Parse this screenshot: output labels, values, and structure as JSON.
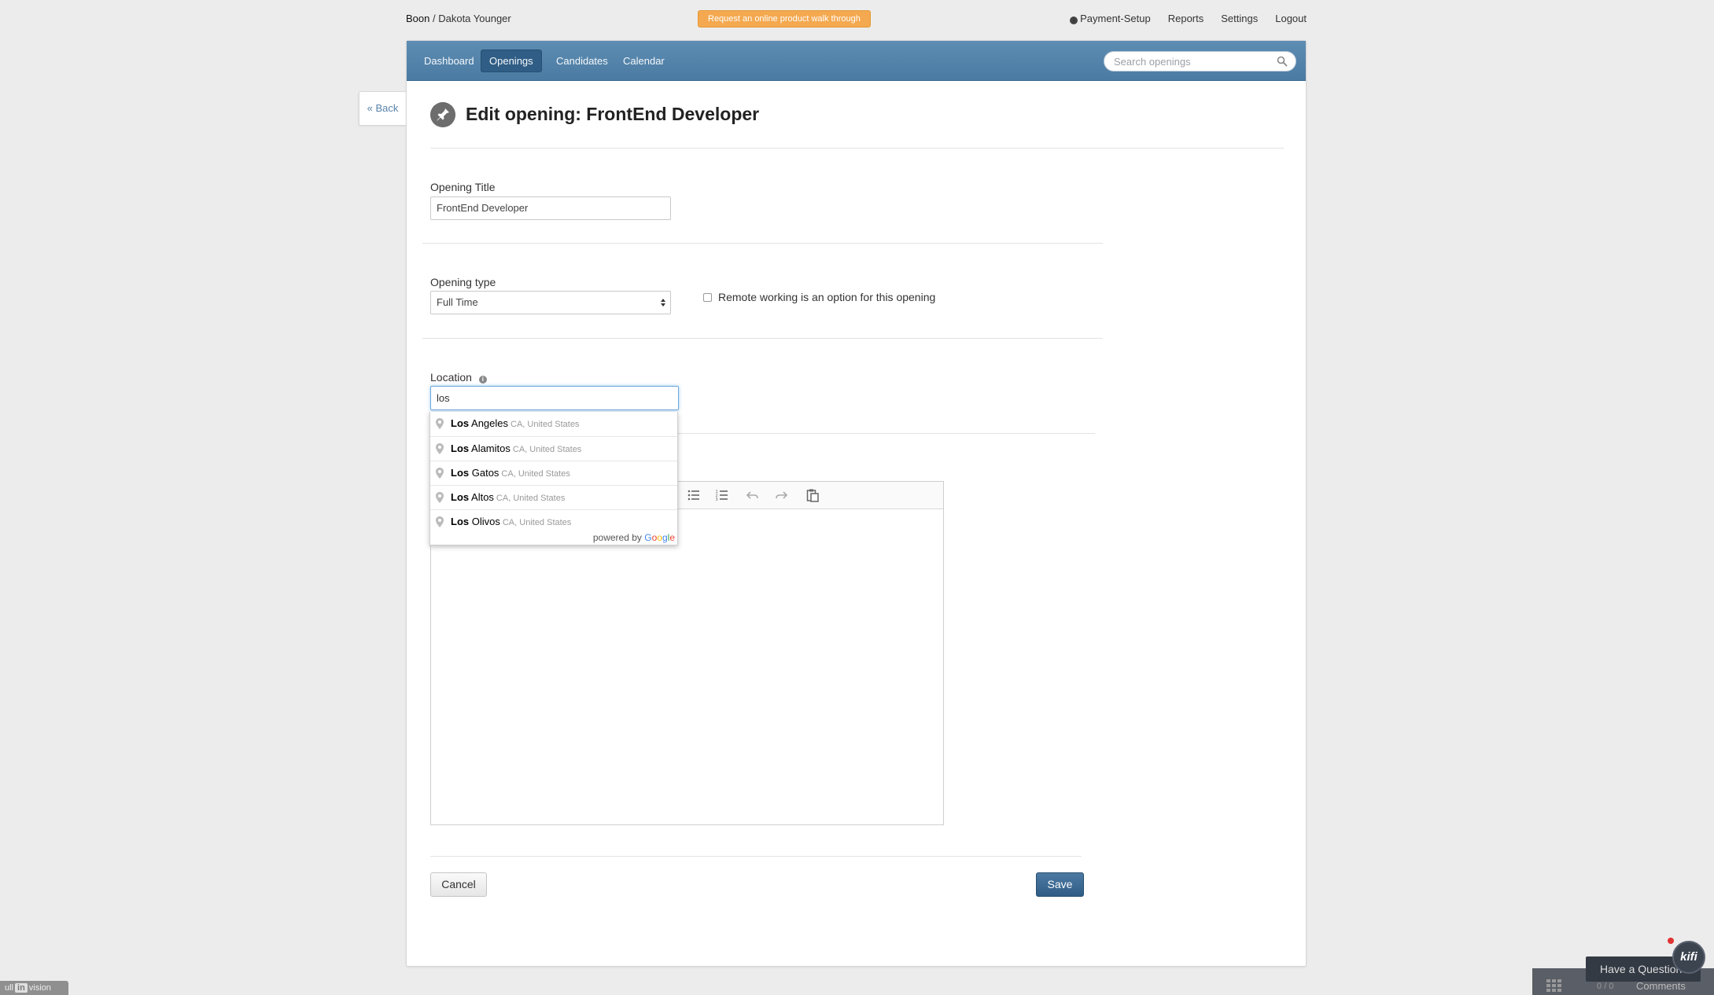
{
  "header": {
    "company": "Boon",
    "separator": " / ",
    "user": "Dakota Younger",
    "walkthrough_button": "Request an online product walk through",
    "links": {
      "payment_setup": "Payment-Setup",
      "reports": "Reports",
      "settings": "Settings",
      "logout": "Logout"
    }
  },
  "nav": {
    "items": [
      {
        "label": "Dashboard"
      },
      {
        "label": "Openings",
        "active": true
      },
      {
        "label": "Candidates"
      },
      {
        "label": "Calendar"
      }
    ],
    "search_placeholder": "Search openings"
  },
  "back_button": "« Back",
  "page_title": "Edit opening: FrontEnd Developer",
  "form": {
    "title_label": "Opening Title",
    "title_value": "FrontEnd Developer",
    "type_label": "Opening type",
    "type_value": "Full Time",
    "remote_label": "Remote working is an option for this opening",
    "remote_checked": false,
    "location_label": "Location",
    "location_value": "los",
    "cancel_label": "Cancel",
    "save_label": "Save"
  },
  "autocomplete": {
    "items": [
      {
        "match": "Los",
        "rest": " Angeles",
        "secondary": "CA, United States"
      },
      {
        "match": "Los",
        "rest": " Alamitos",
        "secondary": "CA, United States"
      },
      {
        "match": "Los",
        "rest": " Gatos",
        "secondary": "CA, United States"
      },
      {
        "match": "Los",
        "rest": " Altos",
        "secondary": "CA, United States"
      },
      {
        "match": "Los",
        "rest": " Olivos",
        "secondary": "CA, United States"
      }
    ],
    "powered_by": "powered by",
    "google": [
      "G",
      "o",
      "o",
      "g",
      "l",
      "e"
    ]
  },
  "widgets": {
    "invision_prefix": "ull",
    "invision_tag": "in",
    "invision_text": "vision",
    "count_a": "0",
    "count_sep": "/",
    "count_b": "0",
    "comments": "Comments",
    "question": "Have a Question?",
    "kifi": "kifi"
  },
  "colors": {
    "nav_blue": "#4b7aa2",
    "walkthrough_orange": "#f4a950",
    "save_blue": "#2f5d85"
  }
}
